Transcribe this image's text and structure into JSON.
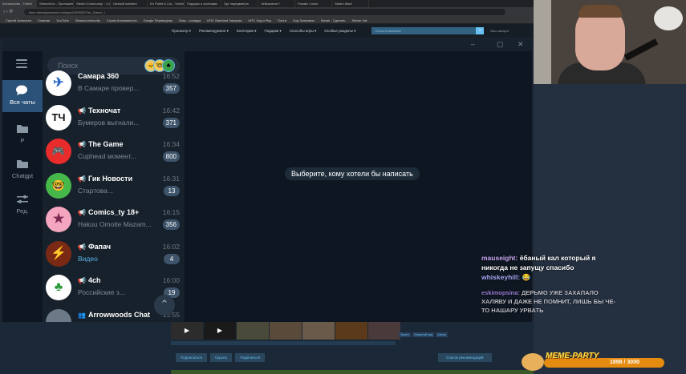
{
  "browser": {
    "tabs": [
      "Arrowwoods - Twitch",
      "StreamVox - Приложение",
      "Steam Community :: Co",
      "Личный кабинет",
      "It's Pullet & Cut - Twitch",
      "Подарки и сертифик",
      "Где передвинуть",
      "Чейкасвить?",
      "Fanatic Cocks",
      "Steam Ивсе"
    ],
    "url": "store.steampowered.com/app/2289530/The_Game/_/",
    "bookmarks": [
      "Сергей Алексеев",
      "Главная",
      "YouTube",
      "Steamcommunity",
      "Стрим Анонимности",
      "Google Переводчик",
      "Zhao - соседка",
      "НПС Standard Загрузка",
      "НПС Ход и Ред",
      "Почта",
      "Ход Экономии",
      "Steam - Сделать",
      "Steam Чат"
    ]
  },
  "steam": {
    "nav": [
      "Просмотр",
      "Рекомендуемое",
      "Категории",
      "Подарки",
      "Способы игры",
      "Особые разделы"
    ],
    "search_placeholder": "Поиск в магазине",
    "account": "Ваш аккаунт",
    "tags": [
      "Экшен",
      "Открытый мир",
      "Шутер"
    ],
    "buttons": [
      "Подписаться",
      "Скрыть",
      "Поделиться"
    ],
    "queue_button": "Список рекомендаций"
  },
  "telegram": {
    "search_placeholder": "Поиск",
    "folders": [
      {
        "label": "Все чаты",
        "icon": "chat-bubbles-icon",
        "active": true
      },
      {
        "label": "Р",
        "icon": "folder-icon",
        "active": false
      },
      {
        "label": "Chatgpt",
        "icon": "folder-icon",
        "active": false
      },
      {
        "label": "Ред.",
        "icon": "edit-sliders-icon",
        "active": false
      }
    ],
    "chats": [
      {
        "name": "Самара 360",
        "time": "16:52",
        "msg": "В Самаре провер...",
        "badge": "357",
        "avatar_color": "#ffffff",
        "avatar_text": "✈",
        "avatar_fg": "#2b6cc8",
        "msg_link": false,
        "name_icon": ""
      },
      {
        "name": "Техночат",
        "time": "16:42",
        "msg": "Бумеров выгнали...",
        "badge": "371",
        "avatar_color": "#ffffff",
        "avatar_text": "ТЧ",
        "avatar_fg": "#111111",
        "msg_link": false,
        "name_icon": "📢"
      },
      {
        "name": "The Game",
        "time": "16:34",
        "msg": "Cuphead момент...",
        "badge": "800",
        "avatar_color": "#e82c2c",
        "avatar_text": "🎮",
        "avatar_fg": "#ffffff",
        "msg_link": false,
        "name_icon": "📢"
      },
      {
        "name": "Гик Новости",
        "time": "16:31",
        "msg": "Стартова...",
        "badge": "13",
        "avatar_color": "#46b84a",
        "avatar_text": "🤓",
        "avatar_fg": "#ffffff",
        "msg_link": false,
        "name_icon": "📢"
      },
      {
        "name": "Comics_ty 18+",
        "time": "16:15",
        "msg": "Hakuu Omoite Mazam...",
        "badge": "356",
        "avatar_color": "#f4a5c0",
        "avatar_text": "★",
        "avatar_fg": "#7a2850",
        "msg_link": false,
        "name_icon": "📢"
      },
      {
        "name": "Фапач",
        "time": "16:02",
        "msg": "Видео",
        "badge": "4",
        "avatar_color": "#7a2a14",
        "avatar_text": "⚡",
        "avatar_fg": "#ff8a2a",
        "msg_link": true,
        "name_icon": "📢"
      },
      {
        "name": "4ch",
        "time": "16:00",
        "msg": "Российские з...",
        "badge": "19",
        "avatar_color": "#ffffff",
        "avatar_text": "♣",
        "avatar_fg": "#2a9a3a",
        "msg_link": false,
        "name_icon": "📢"
      },
      {
        "name": "Arrowwoods Chat",
        "time": "15:55",
        "msg": "",
        "badge": "",
        "avatar_color": "#6c7a88",
        "avatar_text": "",
        "avatar_fg": "#ffffff",
        "msg_link": false,
        "name_icon": "👥"
      }
    ],
    "empty_state": "Выберите, кому хотели бы написать"
  },
  "stream_chat": {
    "messages": [
      {
        "user": "mauseight",
        "text": "ёбаный кал который я никогда не запущу спасибо",
        "color": "#c9a8f5"
      },
      {
        "user": "whiskeyhill",
        "text": "😂",
        "color": "#a9a9f7"
      },
      {
        "user": "eskimopsina",
        "text": "ДЕРЬМО УЖЕ ЗАХАПАЛО ХАЛЯВУ И ДАЖЕ НЕ ПОМНИТ, ЛИШЬ БЫ ЧЕ-ТО НАШАРУ УРВАТЬ",
        "color": "#b38cf0"
      }
    ]
  },
  "meme_party": {
    "label": "MEME-PARTY",
    "count": "1898 / 3000"
  }
}
